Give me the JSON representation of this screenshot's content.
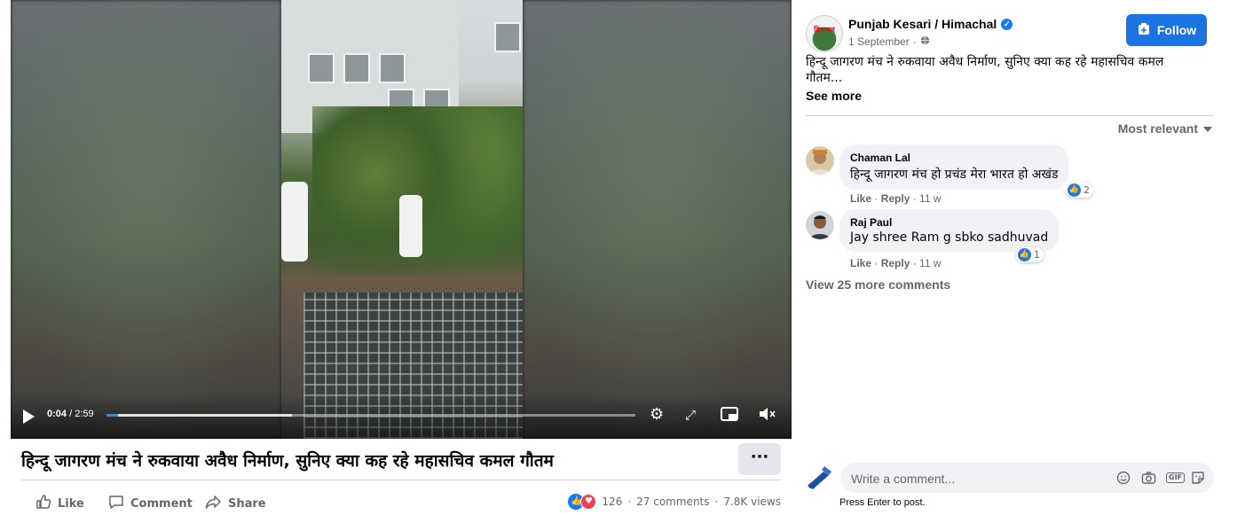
{
  "video": {
    "current_time": "0:04",
    "separator": " / ",
    "duration": "2:59",
    "progress_fraction": 0.0223,
    "buffered_fraction": 0.35
  },
  "post": {
    "title": "हिन्दू जागरण मंच ने रुकवाया अवैध निर्माण, सुनिए क्या कह रहे महासचिव कमल गौतम",
    "more_label": "···",
    "actions": {
      "like": "Like",
      "comment": "Comment",
      "share": "Share"
    },
    "stats": {
      "reactions": "126",
      "dot": "·",
      "comments": "27 comments",
      "views": "7.8K views"
    }
  },
  "page": {
    "name": "Punjab Kesari / Himachal",
    "logo_text": "हिमाचल",
    "date": "1 September",
    "date_sep": "·",
    "follow_label": "Follow",
    "caption": "हिन्दू जागरण मंच ने रुकवाया अवैध निर्माण, सुनिए क्या कह रहे महासचिव कमल गौतम...",
    "see_more": "See more"
  },
  "comments": {
    "sort_label": "Most relevant",
    "items": [
      {
        "author": "Chaman Lal",
        "text": "हिन्दू जागरण मंच हो प्रचंड मेरा भारत हो अखंड",
        "like": "Like",
        "reply": "Reply",
        "time": "11 w",
        "reactions": "2"
      },
      {
        "author": "Raj Paul",
        "text": "Jay shree Ram g sbko sadhuvad",
        "like": "Like",
        "reply": "Reply",
        "time": "11 w",
        "reactions": "1"
      }
    ],
    "view_more": "View 25 more comments",
    "write_placeholder": "Write a comment...",
    "press_enter": "Press Enter to post."
  },
  "colors": {
    "accent": "#1b74e4",
    "like_blue": "#1877f2",
    "love_red": "#f33e58",
    "secondary_text": "#65676b"
  },
  "icons": [
    "play-icon",
    "settings-gear-icon",
    "fullscreen-icon",
    "picture-in-picture-icon",
    "volume-muted-icon",
    "like-icon",
    "comment-icon",
    "share-icon",
    "globe-icon",
    "verified-badge-icon",
    "emoji-icon",
    "camera-icon",
    "gif-icon",
    "sticker-icon"
  ]
}
